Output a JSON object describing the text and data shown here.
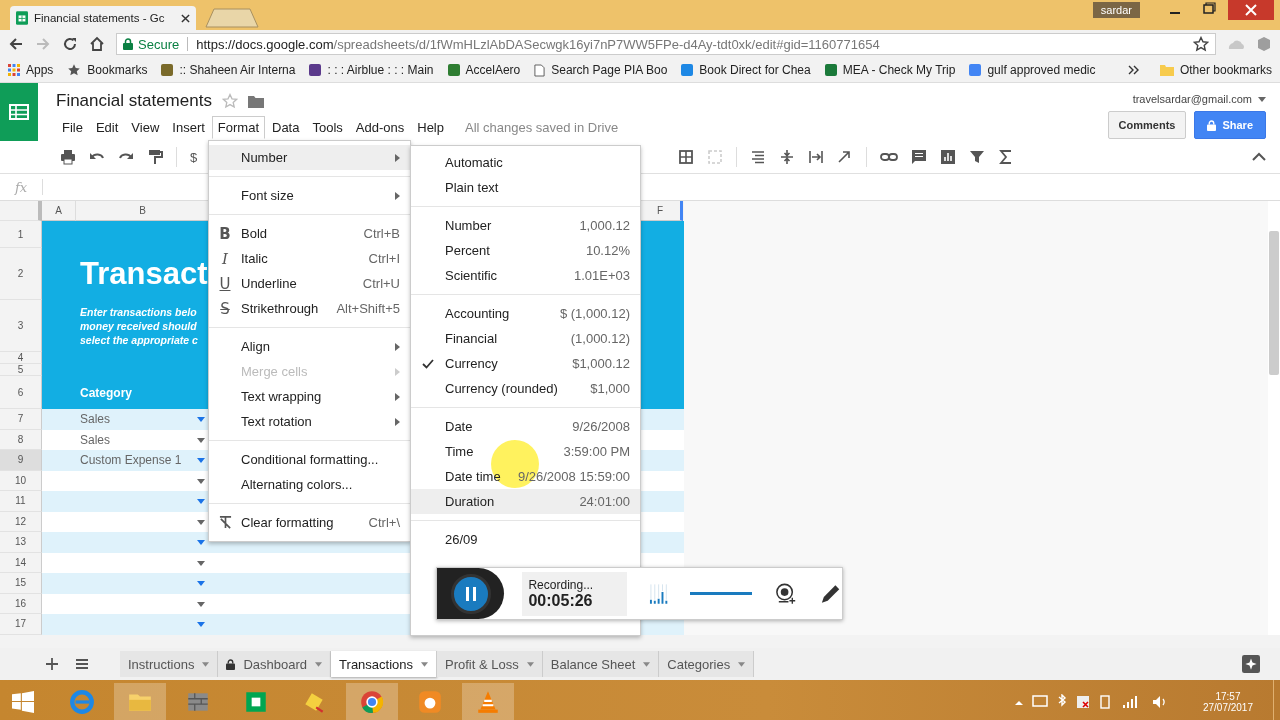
{
  "browser": {
    "tabs": [
      {
        "title": "Financial statements - Gc"
      }
    ],
    "user": "sardar",
    "secure_label": "Secure",
    "url_host": "https://docs.google.com",
    "url_path": "/spreadsheets/d/1fWmHLzlAbDASecwgk16yi7nP7WW5FPe-d4Ay-tdt0xk/edit#gid=1160771654",
    "bookmarks": [
      {
        "label": "Apps",
        "kind": "apps"
      },
      {
        "label": "Bookmarks",
        "kind": "star"
      },
      {
        "label": ":: Shaheen Air Interna",
        "kind": "site",
        "color": "#7a6a2a"
      },
      {
        "label": ": : : Airblue : : : Main",
        "kind": "site",
        "color": "#5b3a8c"
      },
      {
        "label": "AccelAero",
        "kind": "site",
        "color": "#2e7d32"
      },
      {
        "label": "Search Page PIA Boo",
        "kind": "page"
      },
      {
        "label": "Book Direct for Chea",
        "kind": "site",
        "color": "#1e88e5"
      },
      {
        "label": "MEA - Check My Trip",
        "kind": "site",
        "color": "#1b7a3a"
      },
      {
        "label": "gulf approved medic",
        "kind": "site",
        "color": "#4285f4"
      }
    ],
    "other_bookmarks": "Other bookmarks"
  },
  "doc": {
    "title": "Financial statements",
    "account": "travelsardar@gmail.com",
    "save_status": "All changes saved in Drive",
    "comments": "Comments",
    "share": "Share",
    "menu": [
      {
        "label": "File",
        "selected": false
      },
      {
        "label": "Edit",
        "selected": false
      },
      {
        "label": "View",
        "selected": false
      },
      {
        "label": "Insert",
        "selected": false
      },
      {
        "label": "Format",
        "selected": true
      },
      {
        "label": "Data",
        "selected": false
      },
      {
        "label": "Tools",
        "selected": false
      },
      {
        "label": "Add-ons",
        "selected": false
      },
      {
        "label": "Help",
        "selected": false
      }
    ]
  },
  "toolbar": {
    "currency": "$"
  },
  "formula_bar": {
    "label": "fx"
  },
  "sheet": {
    "column_headers": [
      "A",
      "B",
      "F"
    ],
    "rows": [
      {
        "number": "1",
        "kind": "banner",
        "selected": false
      },
      {
        "number": "2",
        "kind": "title",
        "text": "Transact",
        "selected": false
      },
      {
        "number": "3",
        "kind": "description",
        "lines": [
          "Enter transactions belo",
          "money received should",
          "select the appropriate c"
        ],
        "selected": false
      },
      {
        "number": "4",
        "kind": "spacer",
        "selected": false
      },
      {
        "number": "5",
        "kind": "spacer",
        "selected": false
      },
      {
        "number": "6",
        "kind": "header",
        "text": "Category",
        "selected": false
      },
      {
        "number": "7",
        "kind": "data",
        "text": "Sales",
        "selected": false
      },
      {
        "number": "8",
        "kind": "data",
        "text": "Sales",
        "selected": false
      },
      {
        "number": "9",
        "kind": "data",
        "text": "Custom Expense 1",
        "selected": true
      },
      {
        "number": "10",
        "kind": "data",
        "selected": false
      },
      {
        "number": "11",
        "kind": "data",
        "selected": false
      },
      {
        "number": "12",
        "kind": "data",
        "selected": false
      },
      {
        "number": "13",
        "kind": "data",
        "selected": false
      },
      {
        "number": "14",
        "kind": "data",
        "selected": false
      },
      {
        "number": "15",
        "kind": "data",
        "selected": false
      },
      {
        "number": "16",
        "kind": "data",
        "selected": false
      },
      {
        "number": "17",
        "kind": "data",
        "selected": false
      }
    ]
  },
  "format_menu": {
    "groups": [
      [
        {
          "label": "Number",
          "kind": "plain",
          "submenu": true,
          "highlighted": true,
          "disabled": false
        }
      ],
      [
        {
          "label": "Font size",
          "kind": "plain",
          "submenu": true,
          "highlighted": false,
          "disabled": false
        }
      ],
      [
        {
          "label": "Bold",
          "glyph": "B",
          "kind": "bold",
          "shortcut": "Ctrl+B",
          "submenu": false,
          "highlighted": false,
          "disabled": false
        },
        {
          "label": "Italic",
          "glyph": "I",
          "kind": "italic",
          "shortcut": "Ctrl+I",
          "submenu": false,
          "highlighted": false,
          "disabled": false
        },
        {
          "label": "Underline",
          "glyph": "U",
          "kind": "underline",
          "shortcut": "Ctrl+U",
          "submenu": false,
          "highlighted": false,
          "disabled": false
        },
        {
          "label": "Strikethrough",
          "glyph": "S",
          "kind": "strike",
          "shortcut": "Alt+Shift+5",
          "submenu": false,
          "highlighted": false,
          "disabled": false
        }
      ],
      [
        {
          "label": "Align",
          "kind": "plain",
          "submenu": true,
          "highlighted": false,
          "disabled": false
        },
        {
          "label": "Merge cells",
          "kind": "plain",
          "submenu": true,
          "highlighted": false,
          "disabled": true
        },
        {
          "label": "Text wrapping",
          "kind": "plain",
          "submenu": true,
          "highlighted": false,
          "disabled": false
        },
        {
          "label": "Text rotation",
          "kind": "plain",
          "submenu": true,
          "highlighted": false,
          "disabled": false
        }
      ],
      [
        {
          "label": "Conditional formatting...",
          "kind": "plain",
          "submenu": false,
          "highlighted": false,
          "disabled": false
        },
        {
          "label": "Alternating colors...",
          "kind": "plain",
          "submenu": false,
          "highlighted": false,
          "disabled": false
        }
      ],
      [
        {
          "label": "Clear formatting",
          "kind": "clear",
          "shortcut": "Ctrl+\\",
          "submenu": false,
          "highlighted": false,
          "disabled": false
        }
      ]
    ]
  },
  "number_menu": {
    "groups": [
      [
        {
          "label": "Automatic",
          "checked": false,
          "highlighted": false
        },
        {
          "label": "Plain text",
          "checked": false,
          "highlighted": false
        }
      ],
      [
        {
          "label": "Number",
          "sample": "1,000.12",
          "checked": false,
          "highlighted": false
        },
        {
          "label": "Percent",
          "sample": "10.12%",
          "checked": false,
          "highlighted": false
        },
        {
          "label": "Scientific",
          "sample": "1.01E+03",
          "checked": false,
          "highlighted": false
        }
      ],
      [
        {
          "label": "Accounting",
          "sample": "$ (1,000.12)",
          "checked": false,
          "highlighted": false
        },
        {
          "label": "Financial",
          "sample": "(1,000.12)",
          "checked": false,
          "highlighted": false
        },
        {
          "label": "Currency",
          "sample": "$1,000.12",
          "checked": true,
          "highlighted": false
        },
        {
          "label": "Currency (rounded)",
          "sample": "$1,000",
          "checked": false,
          "highlighted": false
        }
      ],
      [
        {
          "label": "Date",
          "sample": "9/26/2008",
          "checked": false,
          "highlighted": false
        },
        {
          "label": "Time",
          "sample": "3:59:00 PM",
          "checked": false,
          "highlighted": false
        },
        {
          "label": "Date time",
          "sample": "9/26/2008 15:59:00",
          "checked": false,
          "highlighted": false
        },
        {
          "label": "Duration",
          "sample": "24:01:00",
          "checked": false,
          "highlighted": true
        }
      ],
      [
        {
          "label": "26/09",
          "checked": false,
          "highlighted": false
        }
      ]
    ]
  },
  "recorder": {
    "status": "Recording...",
    "elapsed": "00:05:26",
    "volume": {
      "level": 1
    }
  },
  "sheet_tabs": [
    {
      "label": "Instructions",
      "selected": false,
      "locked": false
    },
    {
      "label": "Dashboard",
      "selected": false,
      "locked": true
    },
    {
      "label": "Transactions",
      "selected": true,
      "locked": false
    },
    {
      "label": "Profit & Loss",
      "selected": false,
      "locked": false
    },
    {
      "label": "Balance Sheet",
      "selected": false,
      "locked": false
    },
    {
      "label": "Categories",
      "selected": false,
      "locked": false
    }
  ],
  "taskbar": {
    "apps": [
      {
        "kind": "globe",
        "running": false
      },
      {
        "kind": "folder",
        "running": true
      },
      {
        "kind": "wall",
        "running": false
      },
      {
        "kind": "store",
        "running": false
      },
      {
        "kind": "hand",
        "running": false
      },
      {
        "kind": "chrome",
        "running": true
      },
      {
        "kind": "fox",
        "running": false
      },
      {
        "kind": "cone",
        "running": true
      }
    ],
    "time": "17:57",
    "date": "27/07/2017"
  }
}
